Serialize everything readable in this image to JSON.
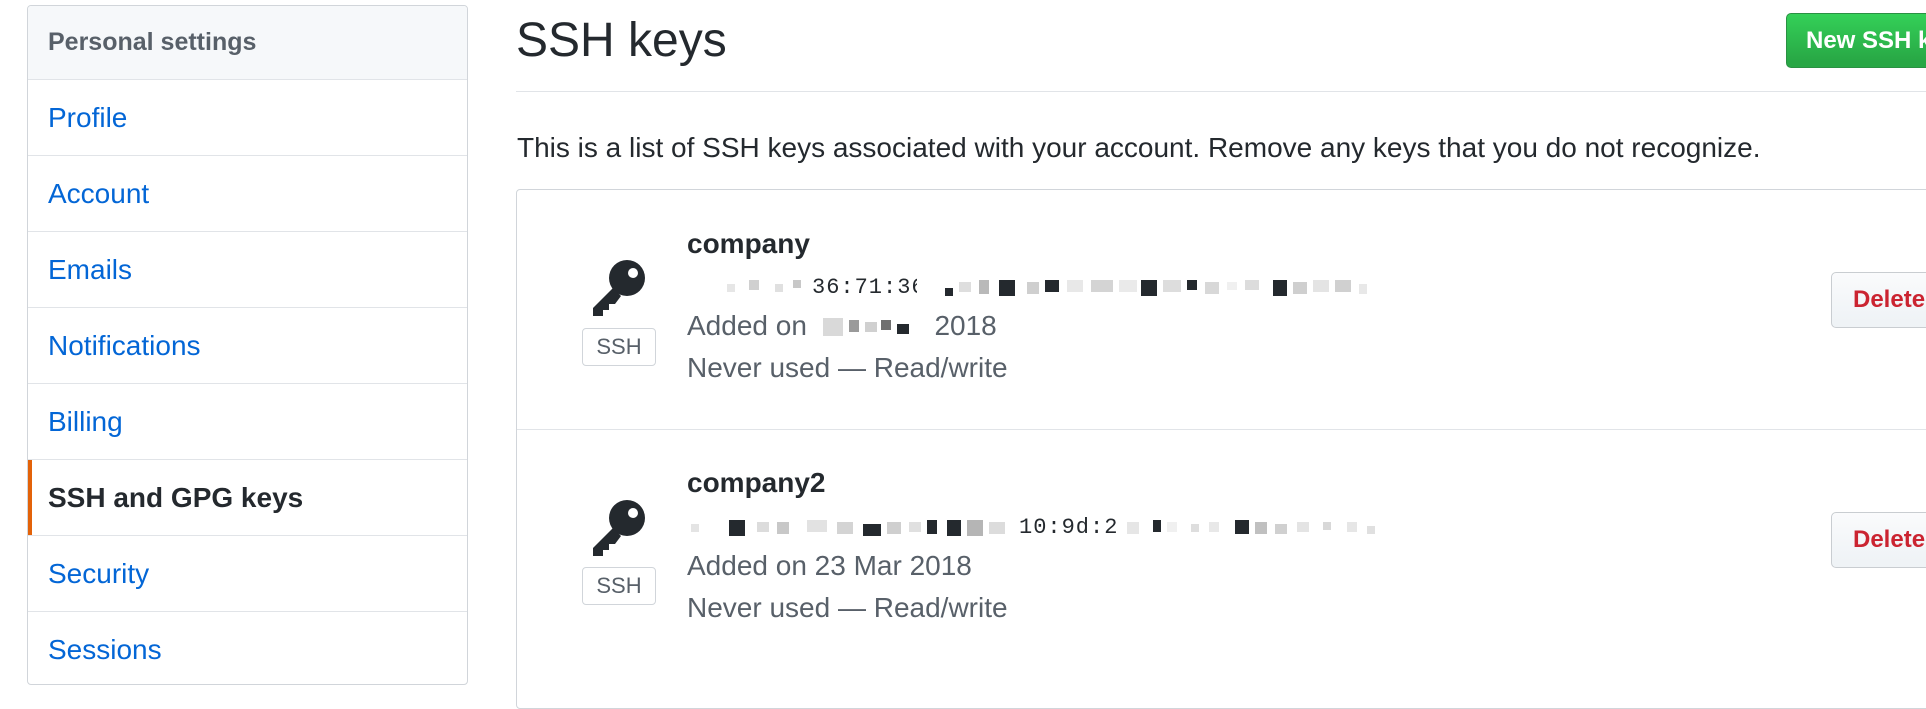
{
  "sidebar": {
    "header": "Personal settings",
    "items": [
      {
        "label": "Profile"
      },
      {
        "label": "Account"
      },
      {
        "label": "Emails"
      },
      {
        "label": "Notifications"
      },
      {
        "label": "Billing"
      },
      {
        "label": "SSH and GPG keys",
        "selected": true
      },
      {
        "label": "Security"
      },
      {
        "label": "Sessions"
      }
    ]
  },
  "main": {
    "title": "SSH keys",
    "new_key_button": "New SSH key",
    "description": "This is a list of SSH keys associated with your account. Remove any keys that you do not recognize.",
    "keys": [
      {
        "title": "company",
        "badge": "SSH",
        "fingerprint_visible": "36:71:36",
        "added": "Added on",
        "added_year": "2018",
        "usage": "Never used — Read/write",
        "delete_label": "Delete"
      },
      {
        "title": "company2",
        "badge": "SSH",
        "fingerprint_visible": "10:9d:2",
        "added": "Added on 23 Mar 2018",
        "usage": "Never used — Read/write",
        "delete_label": "Delete"
      }
    ]
  },
  "colors": {
    "link": "#0366d6",
    "selected_accent": "#e36209",
    "primary_button": "#28a745",
    "danger": "#cb2431",
    "muted_text": "#586069"
  },
  "icons": {
    "key": "key-icon"
  }
}
